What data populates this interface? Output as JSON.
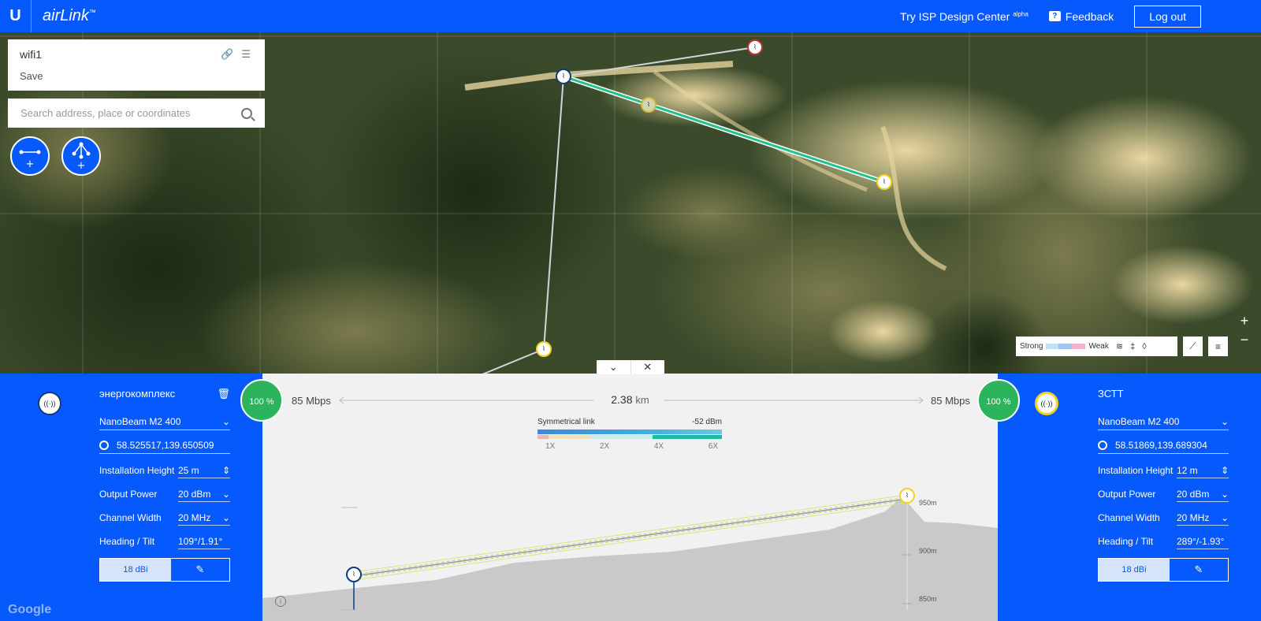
{
  "app": {
    "logo_label": "U",
    "brand": "airLink",
    "brand_sup": "™"
  },
  "header": {
    "isp_link": "Try ISP Design Center",
    "isp_sup": "alpha",
    "feedback": "Feedback",
    "logout": "Log out"
  },
  "project": {
    "name": "wifi1",
    "save": "Save"
  },
  "search": {
    "placeholder": "Search address, place or coordinates"
  },
  "legend": {
    "strong": "Strong",
    "weak": "Weak"
  },
  "link": {
    "left_quality": "100 %",
    "right_quality": "100 %",
    "left_rate": "85 Mbps",
    "right_rate": "85 Mbps",
    "distance_value": "2.38",
    "distance_unit": "km",
    "symmetry": "Symmetrical link",
    "signal": "-52 dBm",
    "ticks": [
      "1X",
      "2X",
      "4X",
      "6X"
    ],
    "elevations": [
      "950m",
      "900m",
      "850m"
    ]
  },
  "left_device": {
    "name": "энергокомплекс",
    "model": "NanoBeam M2 400",
    "coords": "58.525517,139.650509",
    "installation_height_label": "Installation Height",
    "installation_height": "25 m",
    "output_power_label": "Output Power",
    "output_power": "20 dBm",
    "channel_width_label": "Channel Width",
    "channel_width": "20 MHz",
    "heading_label": "Heading / Tilt",
    "heading": "109°/1.91°",
    "antenna_gain": "18 dBi"
  },
  "right_device": {
    "name": "ЗСТТ",
    "model": "NanoBeam M2 400",
    "coords": "58.51869,139.689304",
    "installation_height_label": "Installation Height",
    "installation_height": "12 m",
    "output_power_label": "Output Power",
    "output_power": "20 dBm",
    "channel_width_label": "Channel Width",
    "channel_width": "20 MHz",
    "heading_label": "Heading / Tilt",
    "heading": "289°/-1.93°",
    "antenna_gain": "18 dBi"
  },
  "footer": {
    "google": "Google"
  },
  "colors": {
    "brand_blue": "#0559fd",
    "success_green": "#2cb45c",
    "link_green": "#1fc287"
  }
}
